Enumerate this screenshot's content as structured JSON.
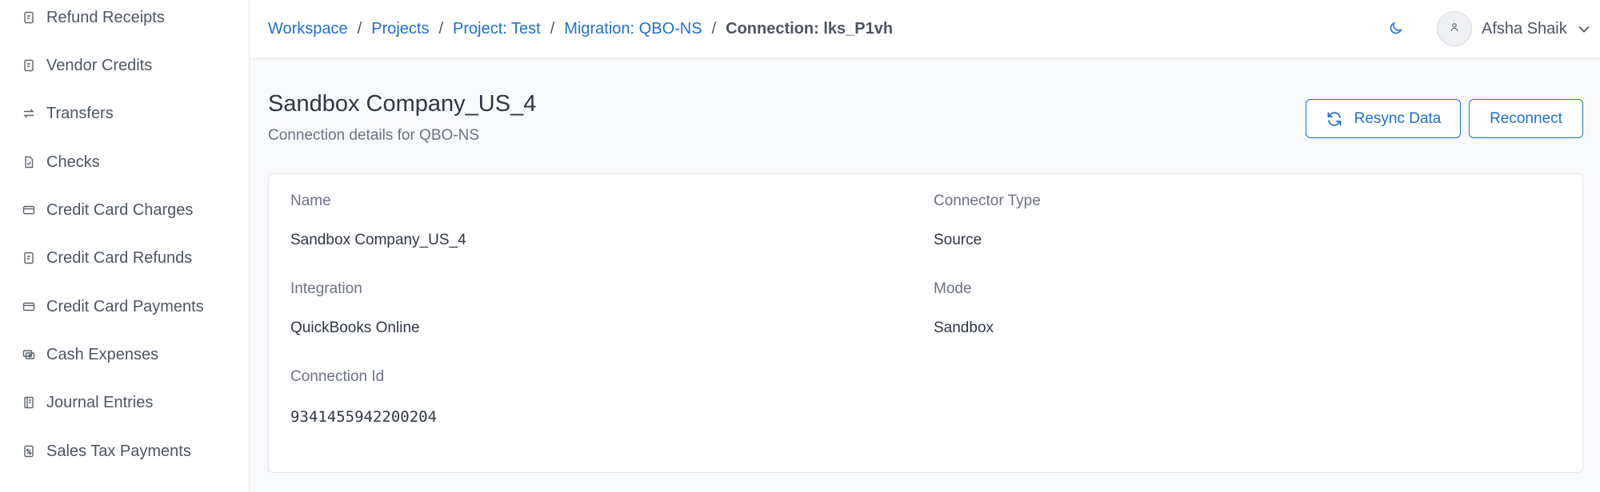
{
  "sidebar": {
    "items": [
      {
        "label": "Refund Receipts",
        "icon": "receipt-icon"
      },
      {
        "label": "Vendor Credits",
        "icon": "receipt-icon"
      },
      {
        "label": "Transfers",
        "icon": "transfer-arrows-icon"
      },
      {
        "label": "Checks",
        "icon": "check-document-icon"
      },
      {
        "label": "Credit Card Charges",
        "icon": "credit-card-icon"
      },
      {
        "label": "Credit Card Refunds",
        "icon": "receipt-icon"
      },
      {
        "label": "Credit Card Payments",
        "icon": "credit-card-icon"
      },
      {
        "label": "Cash Expenses",
        "icon": "cash-icon"
      },
      {
        "label": "Journal Entries",
        "icon": "journal-icon"
      },
      {
        "label": "Sales Tax Payments",
        "icon": "tax-receipt-icon"
      }
    ]
  },
  "breadcrumb": {
    "items": [
      "Workspace",
      "Projects",
      "Project: Test",
      "Migration: QBO-NS"
    ],
    "separator": "/",
    "current": "Connection: lks_P1vh"
  },
  "header": {
    "theme_icon": "moon-icon",
    "user_name": "Afsha Shaik"
  },
  "page": {
    "title": "Sandbox Company_US_4",
    "subtitle": "Connection details for QBO-NS",
    "resync_label": "Resync Data",
    "reconnect_label": "Reconnect"
  },
  "details": {
    "name_label": "Name",
    "name_value": "Sandbox Company_US_4",
    "connector_type_label": "Connector Type",
    "connector_type_value": "Source",
    "integration_label": "Integration",
    "integration_value": "QuickBooks Online",
    "mode_label": "Mode",
    "mode_value": "Sandbox",
    "connection_id_label": "Connection Id",
    "connection_id_value": "9341455942200204"
  },
  "colors": {
    "accent": "#1f6fd0",
    "text": "#2f3742",
    "muted": "#6b7280",
    "background": "#f8f9fb"
  }
}
